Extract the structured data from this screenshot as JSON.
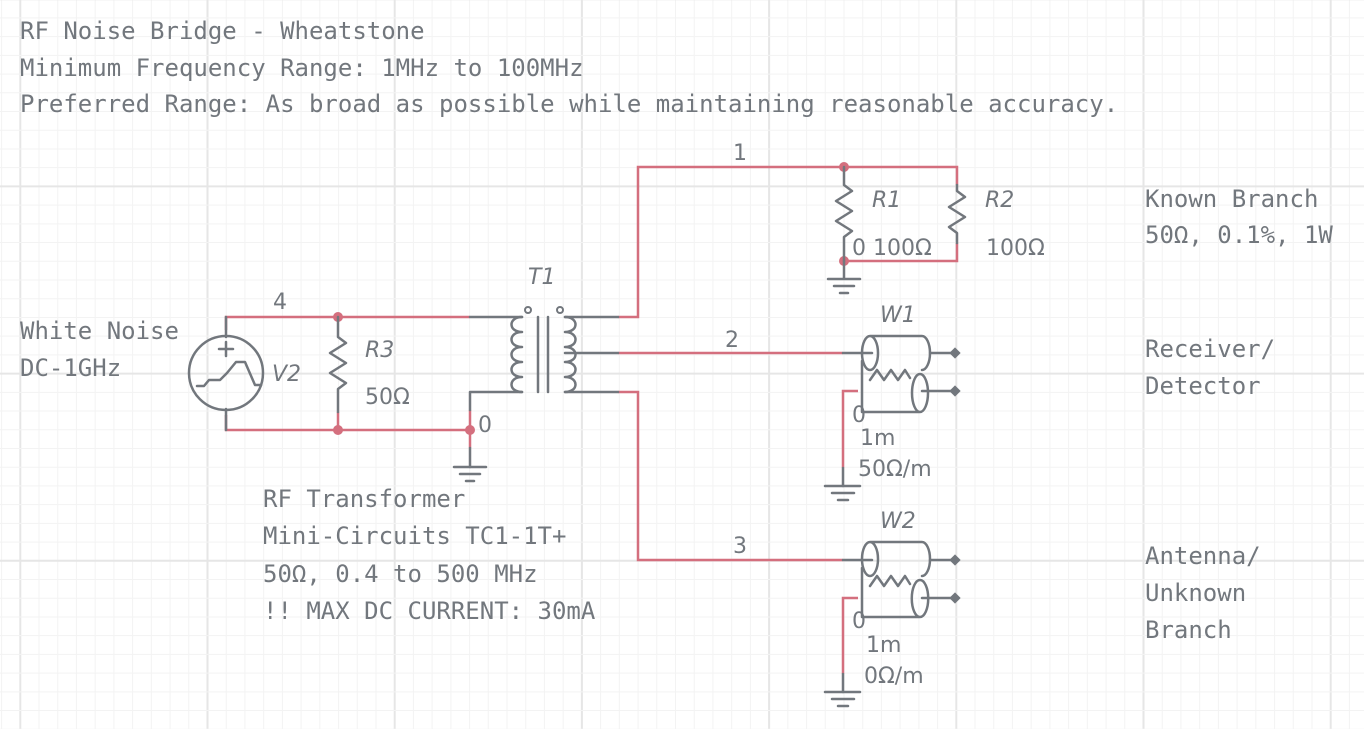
{
  "header": {
    "title": "RF Noise Bridge - Wheatstone",
    "min_range": "Minimum Frequency Range: 1MHz to 100MHz",
    "preferred_range": "Preferred Range: As broad as possible while maintaining reasonable accuracy."
  },
  "colors": {
    "wire": "#d46f7e",
    "component": "#72777d",
    "grid_minor": "#f3f3f3",
    "grid_major": "#e6e6e6"
  },
  "nets": {
    "n1": "1",
    "n2": "2",
    "n3": "3",
    "n4": "4",
    "gnd_transformer": "0",
    "gnd_r1": "0",
    "gnd_w1": "0",
    "gnd_w2": "0"
  },
  "components": {
    "v2": {
      "ref": "V2",
      "icon": "noise-voltage-source-icon",
      "note_line1": "White Noise",
      "note_line2": "DC-1GHz"
    },
    "r3": {
      "ref": "R3",
      "value": "50Ω"
    },
    "t1": {
      "ref": "T1",
      "note_line1": "RF Transformer",
      "note_line2": "Mini-Circuits TC1-1T+",
      "note_line3": "50Ω, 0.4 to 500 MHz",
      "note_line4": "!! MAX DC CURRENT: 30mA"
    },
    "r1": {
      "ref": "R1",
      "value": "100Ω"
    },
    "r2": {
      "ref": "R2",
      "value": "100Ω"
    },
    "w1": {
      "ref": "W1",
      "length": "1m",
      "impedance": "50Ω/m"
    },
    "w2": {
      "ref": "W2",
      "length": "1m",
      "impedance": "0Ω/m"
    }
  },
  "annotations": {
    "known_branch_line1": "Known Branch",
    "known_branch_line2": "50Ω, 0.1%, 1W",
    "receiver_line1": "Receiver/",
    "receiver_line2": "Detector",
    "antenna_line1": "Antenna/",
    "antenna_line2": "Unknown",
    "antenna_line3": "Branch"
  }
}
